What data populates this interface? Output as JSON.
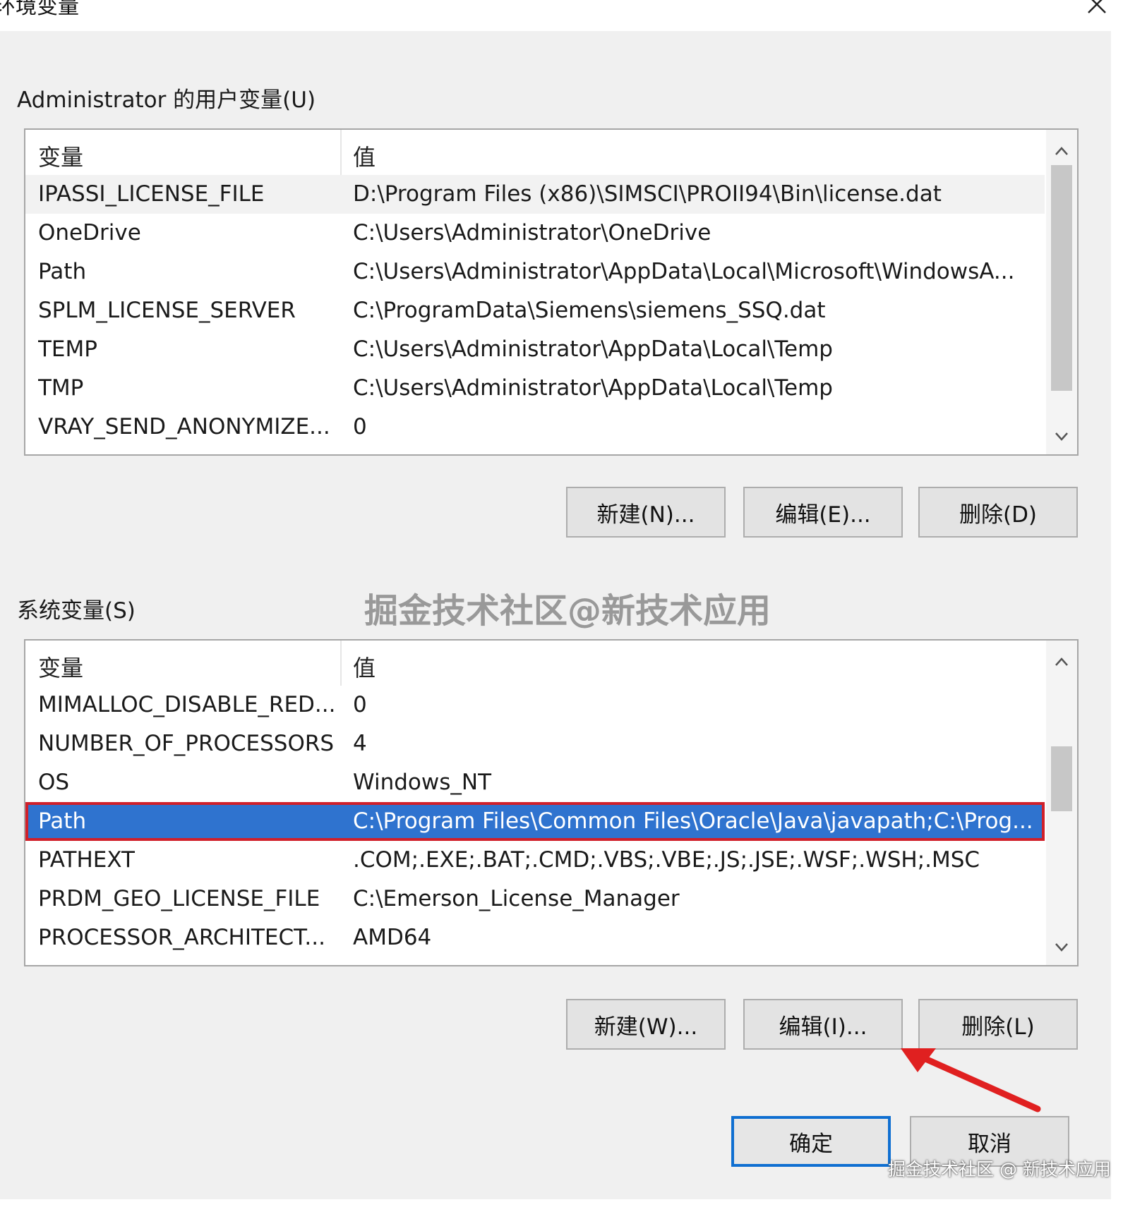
{
  "window": {
    "title": "环境变量"
  },
  "user_vars": {
    "label": "Administrator 的用户变量(U)",
    "columns": {
      "variable": "变量",
      "value": "值"
    },
    "rows": [
      {
        "name": "IPASSI_LICENSE_FILE",
        "value": "D:\\Program Files (x86)\\SIMSCI\\PROII94\\Bin\\license.dat"
      },
      {
        "name": "OneDrive",
        "value": "C:\\Users\\Administrator\\OneDrive"
      },
      {
        "name": "Path",
        "value": "C:\\Users\\Administrator\\AppData\\Local\\Microsoft\\WindowsA..."
      },
      {
        "name": "SPLM_LICENSE_SERVER",
        "value": "C:\\ProgramData\\Siemens\\siemens_SSQ.dat"
      },
      {
        "name": "TEMP",
        "value": "C:\\Users\\Administrator\\AppData\\Local\\Temp"
      },
      {
        "name": "TMP",
        "value": "C:\\Users\\Administrator\\AppData\\Local\\Temp"
      },
      {
        "name": "VRAY_SEND_ANONYMIZE...",
        "value": "0"
      }
    ],
    "buttons": {
      "new": "新建(N)...",
      "edit": "编辑(E)...",
      "delete": "删除(D)"
    }
  },
  "system_vars": {
    "label": "系统变量(S)",
    "columns": {
      "variable": "变量",
      "value": "值"
    },
    "rows": [
      {
        "name": "MIMALLOC_DISABLE_RED...",
        "value": "0"
      },
      {
        "name": "NUMBER_OF_PROCESSORS",
        "value": "4"
      },
      {
        "name": "OS",
        "value": "Windows_NT"
      },
      {
        "name": "Path",
        "value": "C:\\Program Files\\Common Files\\Oracle\\Java\\javapath;C:\\Prog..."
      },
      {
        "name": "PATHEXT",
        "value": ".COM;.EXE;.BAT;.CMD;.VBS;.VBE;.JS;.JSE;.WSF;.WSH;.MSC"
      },
      {
        "name": "PRDM_GEO_LICENSE_FILE",
        "value": "C:\\Emerson_License_Manager"
      },
      {
        "name": "PROCESSOR_ARCHITECT...",
        "value": "AMD64"
      }
    ],
    "selected_row": "Path",
    "buttons": {
      "new": "新建(W)...",
      "edit": "编辑(I)...",
      "delete": "删除(L)"
    }
  },
  "footer": {
    "ok": "确定",
    "cancel": "取消"
  },
  "watermark": {
    "main": "掘金技术社区@新技术应用",
    "corner": "掘金技术社区 @ 新技术应用"
  },
  "colors": {
    "selection": "#2f73cf",
    "highlight_border": "#d0202a",
    "annotation_arrow": "#e02020",
    "default_button_border": "#0f6fd1"
  }
}
